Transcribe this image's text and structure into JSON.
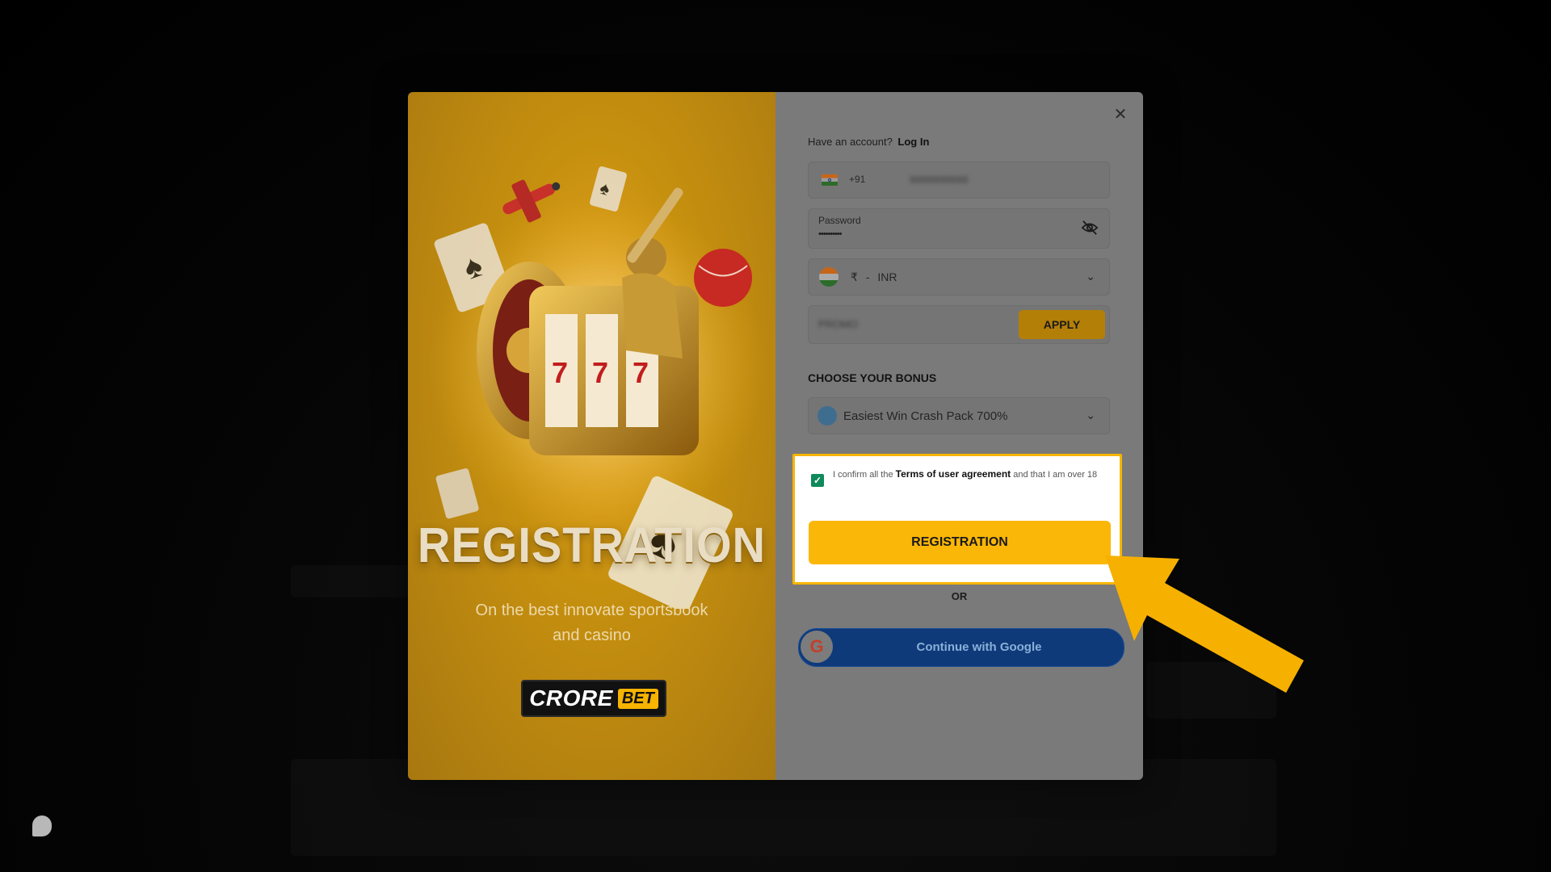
{
  "promo": {
    "title": "REGISTRATION",
    "subtitle_line1": "On the best innovate sportsbook",
    "subtitle_line2": "and casino",
    "logo_main": "CRORE",
    "logo_accent": "BET"
  },
  "form": {
    "have_account": "Have an account?",
    "login_link": "Log In",
    "phone": {
      "country_code": "+91",
      "value": "9999999999"
    },
    "password": {
      "label": "Password",
      "value": "••••••••••"
    },
    "currency": {
      "symbol": "₹",
      "separator": "-",
      "code": "INR"
    },
    "promo_code": {
      "value": "PROMO",
      "apply_label": "APPLY"
    },
    "bonus_section_label": "CHOOSE YOUR BONUS",
    "bonus_selected": "Easiest Win Crash Pack 700%",
    "terms": {
      "prefix": "I confirm all the",
      "link": "Terms of user agreement",
      "suffix": "and that I am over 18",
      "checked": true
    },
    "register_label": "REGISTRATION",
    "or_label": "OR",
    "google_label": "Continue with Google",
    "google_icon": "G"
  },
  "colors": {
    "accent": "#fbb707",
    "google_button": "#0f3a7a",
    "checkbox": "#0f8a5a"
  },
  "icons": {
    "close": "close-icon",
    "eye": "eye-off-icon",
    "chevron": "chevron-down-icon"
  }
}
